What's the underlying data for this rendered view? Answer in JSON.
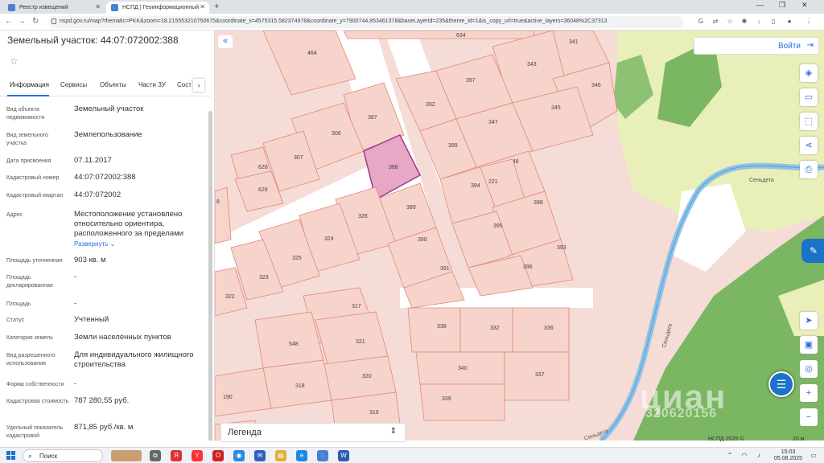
{
  "browser": {
    "tabs": [
      {
        "label": "Реестр извещений"
      },
      {
        "label": "НСПД | Геоинформационный"
      }
    ],
    "url": "nspd.gov.ru/map?thematic=PKK&zoom=18.215553210750675&coordinate_x=4575315.582374978&coordinate_y=7900744.853461378&baseLayerId=235&theme_id=1&is_copy_url=true&active_layers=36048%2C37313"
  },
  "panel": {
    "title": "Земельный участок: 44:07:072002:388",
    "tabs": [
      "Информация",
      "Сервисы",
      "Объекты",
      "Части ЗУ",
      "Сост"
    ],
    "expand_label": "Развернуть",
    "fields": [
      {
        "label": "Вид объекта недвижимости",
        "value": "Земельный участок"
      },
      {
        "label": "Вид земельного участка",
        "value": "Землепользование"
      },
      {
        "label": "Дата присвоения",
        "value": "07.11.2017"
      },
      {
        "label": "Кадастровый номер",
        "value": "44:07:072002:388"
      },
      {
        "label": "Кадастровый квартал",
        "value": "44:07:072002"
      },
      {
        "label": "Адрес",
        "value": "Местоположение установлено относительно ориентира, расположенного за пределами"
      },
      {
        "label": "Площадь уточненная",
        "value": "903 кв. м"
      },
      {
        "label": "Площадь декларированная",
        "value": "-"
      },
      {
        "label": "Площадь",
        "value": "-"
      },
      {
        "label": "Статус",
        "value": "Учтенный"
      },
      {
        "label": "Категория земель",
        "value": "Земли населенных пунктов"
      },
      {
        "label": "Вид разрешенного использования",
        "value": "Для индивидуального жилищного строительства"
      },
      {
        "label": "Форма собственности",
        "value": "-"
      },
      {
        "label": "Кадастровая стоимость",
        "value": "787 280,55 руб."
      },
      {
        "label": "Удельный показатель кадастровой",
        "value": "871,85 руб./кв. м"
      }
    ]
  },
  "map": {
    "login_label": "Войти",
    "legend_label": "Легенда",
    "footer": "НСПД 2025 ©",
    "scale": "20 м",
    "river_label_1": "Сеньдега",
    "river_label_2": "Сеньдега",
    "watermark": "циан",
    "watermark_id": "320620156",
    "plots": [
      "634",
      "464",
      "341",
      "343",
      "346",
      "397",
      "392",
      "345",
      "387",
      "347",
      "306",
      "399",
      "307",
      "628",
      "388",
      "348",
      "629",
      "394",
      "221",
      "398",
      "389",
      "328",
      "395",
      "324",
      "390",
      "393",
      "325",
      "391",
      "396",
      "323",
      "322",
      "317",
      "338",
      "332",
      "336",
      "548",
      "321",
      "340",
      "337",
      "320",
      "318",
      "339",
      "190",
      "319",
      "189",
      "8"
    ],
    "colors": {
      "plot_fill": "#f6d4cc",
      "plot_stroke": "#e08878",
      "selected_fill": "#e6a8c4",
      "selected_stroke": "#9b3a8a",
      "forest": "#7bb662",
      "meadow": "#e8efb8",
      "river": "#8fc3e8"
    }
  },
  "taskbar": {
    "search_label": "Поиск",
    "time": "15:03",
    "date": "05.08.2025"
  }
}
